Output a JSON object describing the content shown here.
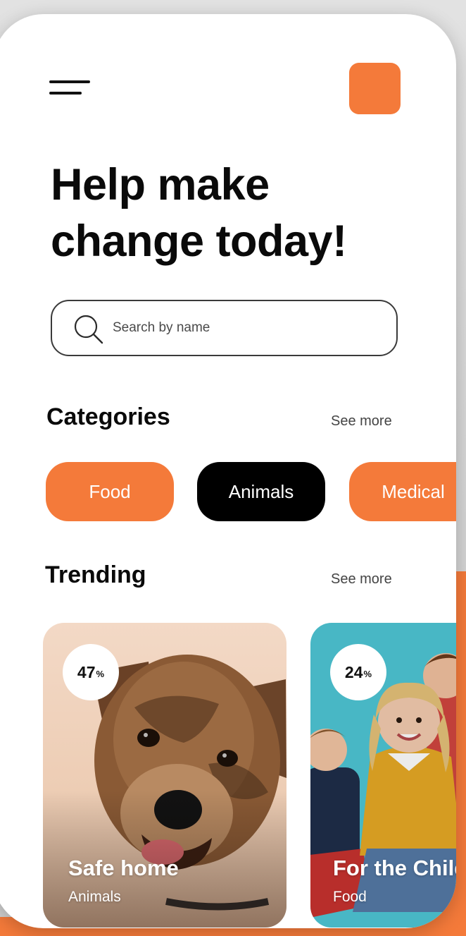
{
  "header": {
    "menu_icon": "hamburger-menu-icon",
    "profile_color": "#f47a3a"
  },
  "headline": "Help make change today!",
  "search": {
    "placeholder": "Search by name",
    "icon": "search-icon"
  },
  "categories": {
    "title": "Categories",
    "see_more": "See more",
    "chips": [
      {
        "label": "Food",
        "active": false
      },
      {
        "label": "Animals",
        "active": true
      },
      {
        "label": "Medical",
        "active": false
      }
    ]
  },
  "trending": {
    "title": "Trending",
    "see_more": "See more",
    "cards": [
      {
        "percent": "47",
        "percent_sign": "%",
        "progress": 0.47,
        "title": "Safe home",
        "category": "Animals",
        "image": "dog-photo"
      },
      {
        "percent": "24",
        "percent_sign": "%",
        "progress": 0.24,
        "title": "For the Children",
        "category": "Food",
        "image": "children-photo"
      }
    ]
  },
  "colors": {
    "accent": "#f47a3a",
    "text": "#0a0a0a",
    "chip_active": "#000000"
  }
}
